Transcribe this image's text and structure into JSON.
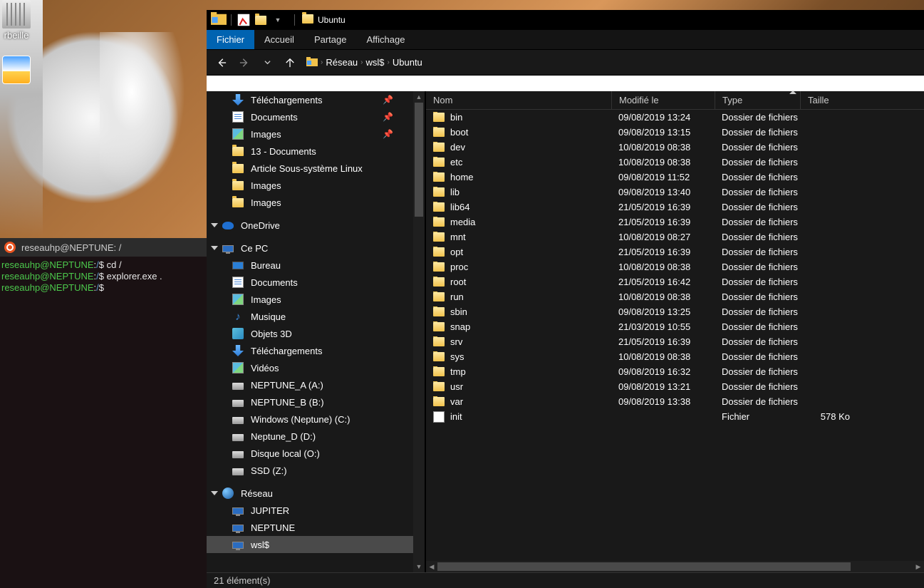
{
  "desktop": {
    "trash_label": "rbeille",
    "weather_label": ""
  },
  "terminal": {
    "title": "reseauhp@NEPTUNE: /",
    "prompt_user": "reseauhp@NEPTUNE",
    "prompt_path": "/",
    "lines": [
      {
        "cmd": "cd /"
      },
      {
        "cmd": "explorer.exe ."
      },
      {
        "cmd": ""
      }
    ]
  },
  "explorer": {
    "title": "Ubuntu",
    "ribbon": {
      "file": "Fichier",
      "home": "Accueil",
      "share": "Partage",
      "view": "Affichage"
    },
    "breadcrumb": [
      "Réseau",
      "wsl$",
      "Ubuntu"
    ],
    "nav": {
      "quick": [
        {
          "label": "Téléchargements",
          "icon": "dl",
          "pin": true
        },
        {
          "label": "Documents",
          "icon": "doc",
          "pin": true
        },
        {
          "label": "Images",
          "icon": "img",
          "pin": true
        },
        {
          "label": "13 - Documents",
          "icon": "fld"
        },
        {
          "label": "Article Sous-système Linux",
          "icon": "fld"
        },
        {
          "label": "Images",
          "icon": "fld"
        },
        {
          "label": "Images",
          "icon": "fld"
        }
      ],
      "onedrive": "OneDrive",
      "thispc_label": "Ce PC",
      "thispc": [
        {
          "label": "Bureau",
          "icon": "desk"
        },
        {
          "label": "Documents",
          "icon": "doc"
        },
        {
          "label": "Images",
          "icon": "img"
        },
        {
          "label": "Musique",
          "icon": "music"
        },
        {
          "label": "Objets 3D",
          "icon": "3d"
        },
        {
          "label": "Téléchargements",
          "icon": "dl"
        },
        {
          "label": "Vidéos",
          "icon": "img"
        },
        {
          "label": "NEPTUNE_A (A:)",
          "icon": "drive"
        },
        {
          "label": "NEPTUNE_B (B:)",
          "icon": "drive"
        },
        {
          "label": "Windows (Neptune) (C:)",
          "icon": "drive"
        },
        {
          "label": "Neptune_D (D:)",
          "icon": "drive"
        },
        {
          "label": "Disque local (O:)",
          "icon": "drive"
        },
        {
          "label": "SSD (Z:)",
          "icon": "drive"
        }
      ],
      "network_label": "Réseau",
      "network": [
        {
          "label": "JUPITER",
          "icon": "pc"
        },
        {
          "label": "NEPTUNE",
          "icon": "pc"
        },
        {
          "label": "wsl$",
          "icon": "pc",
          "selected": true
        }
      ]
    },
    "columns": {
      "name": "Nom",
      "modified": "Modifié le",
      "type": "Type",
      "size": "Taille"
    },
    "folder_type": "Dossier de fichiers",
    "file_type": "Fichier",
    "files": [
      {
        "name": "bin",
        "mod": "09/08/2019 13:24",
        "t": "d"
      },
      {
        "name": "boot",
        "mod": "09/08/2019 13:15",
        "t": "d"
      },
      {
        "name": "dev",
        "mod": "10/08/2019 08:38",
        "t": "d"
      },
      {
        "name": "etc",
        "mod": "10/08/2019 08:38",
        "t": "d"
      },
      {
        "name": "home",
        "mod": "09/08/2019 11:52",
        "t": "d"
      },
      {
        "name": "lib",
        "mod": "09/08/2019 13:40",
        "t": "d"
      },
      {
        "name": "lib64",
        "mod": "21/05/2019 16:39",
        "t": "d"
      },
      {
        "name": "media",
        "mod": "21/05/2019 16:39",
        "t": "d"
      },
      {
        "name": "mnt",
        "mod": "10/08/2019 08:27",
        "t": "d"
      },
      {
        "name": "opt",
        "mod": "21/05/2019 16:39",
        "t": "d"
      },
      {
        "name": "proc",
        "mod": "10/08/2019 08:38",
        "t": "d"
      },
      {
        "name": "root",
        "mod": "21/05/2019 16:42",
        "t": "d"
      },
      {
        "name": "run",
        "mod": "10/08/2019 08:38",
        "t": "d"
      },
      {
        "name": "sbin",
        "mod": "09/08/2019 13:25",
        "t": "d"
      },
      {
        "name": "snap",
        "mod": "21/03/2019 10:55",
        "t": "d"
      },
      {
        "name": "srv",
        "mod": "21/05/2019 16:39",
        "t": "d"
      },
      {
        "name": "sys",
        "mod": "10/08/2019 08:38",
        "t": "d"
      },
      {
        "name": "tmp",
        "mod": "09/08/2019 16:32",
        "t": "d"
      },
      {
        "name": "usr",
        "mod": "09/08/2019 13:21",
        "t": "d"
      },
      {
        "name": "var",
        "mod": "09/08/2019 13:38",
        "t": "d"
      },
      {
        "name": "init",
        "mod": "",
        "t": "f",
        "size": "578 Ko"
      }
    ],
    "status": "21 élément(s)"
  }
}
